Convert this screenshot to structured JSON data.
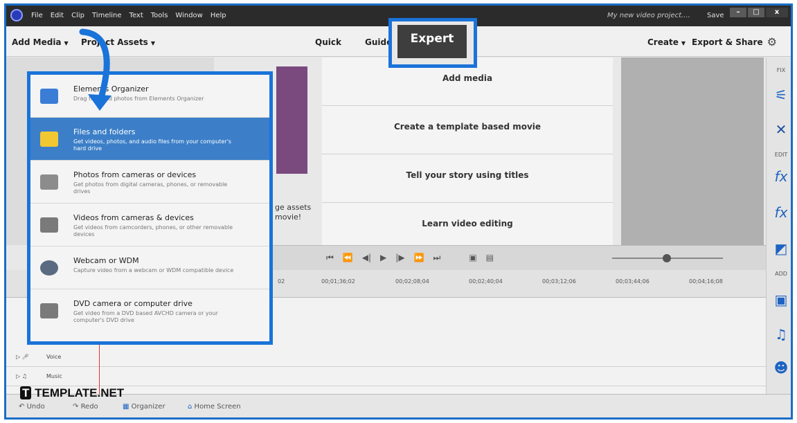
{
  "titlebar": {
    "menu": [
      "File",
      "Edit",
      "Clip",
      "Timeline",
      "Text",
      "Tools",
      "Window",
      "Help"
    ],
    "project_name": "My new video project....",
    "save_label": "Save"
  },
  "toolbar": {
    "add_media": "Add Media",
    "project_assets": "Project Assets",
    "tab_quick": "Quick",
    "tab_guided": "Guide",
    "tab_expert": "Expert",
    "create": "Create",
    "export_share": "Export & Share"
  },
  "dropdown": {
    "items": [
      {
        "title": "Elements Organizer",
        "desc": "Drag files and photos from Elements Organizer",
        "icon": "organizer-icon"
      },
      {
        "title": "Files and folders",
        "desc": "Get videos, photos, and audio files from your computer's hard drive",
        "icon": "folder-icon"
      },
      {
        "title": "Photos from cameras or devices",
        "desc": "Get photos from digital cameras, phones, or removable drives",
        "icon": "camera-icon"
      },
      {
        "title": "Videos from cameras & devices",
        "desc": "Get videos from camcorders, phones, or other removable devices",
        "icon": "camcorder-icon"
      },
      {
        "title": "Webcam or WDM",
        "desc": "Capture video from a webcam or WDM compatible device",
        "icon": "webcam-icon"
      },
      {
        "title": "DVD camera or computer drive",
        "desc": "Get video from a DVD based AVCHD camera or your computer's DVD drive",
        "icon": "dvd-camera-icon"
      }
    ]
  },
  "assets_hint": [
    "ge assets",
    "movie!"
  ],
  "center": {
    "rows": [
      "Add media",
      "Create a template based movie",
      "Tell your story using titles",
      "Learn video editing"
    ]
  },
  "rightbar": {
    "fix_label": "FIX",
    "edit_label": "EDIT",
    "add_label": "ADD"
  },
  "ruler": [
    "02",
    "00;01;36;02",
    "00;02;08;04",
    "00;02;40;04",
    "00;03;12;06",
    "00;03;44;06",
    "00;04;16;08"
  ],
  "tracks": {
    "voice_label": "Voice",
    "music_label": "Music"
  },
  "bottombar": {
    "undo": "Undo",
    "redo": "Redo",
    "organizer": "Organizer",
    "home": "Home Screen"
  },
  "watermark": "TEMPLATE.NET"
}
